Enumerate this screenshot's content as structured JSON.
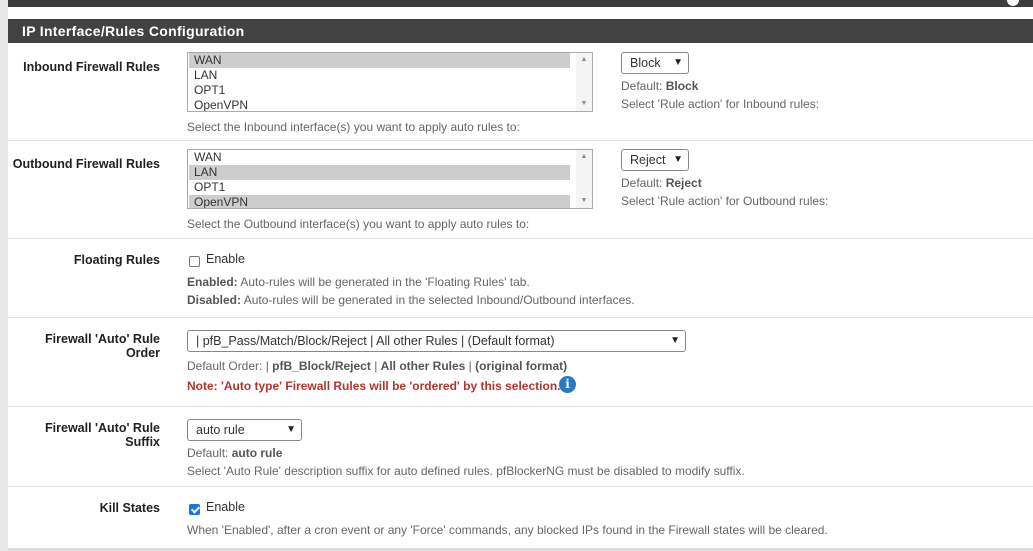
{
  "panel": {
    "title": "IP Interface/Rules Configuration"
  },
  "inbound": {
    "label": "Inbound Firewall Rules",
    "interfaces": [
      {
        "name": "WAN",
        "selected": true
      },
      {
        "name": "LAN",
        "selected": false
      },
      {
        "name": "OPT1",
        "selected": false
      },
      {
        "name": "OpenVPN",
        "selected": false
      }
    ],
    "help": "Select the Inbound interface(s) you want to apply auto rules to:",
    "action_value": "Block",
    "default_prefix": "Default: ",
    "default_value": "Block",
    "action_help": "Select 'Rule action' for Inbound rules:"
  },
  "outbound": {
    "label": "Outbound Firewall Rules",
    "interfaces": [
      {
        "name": "WAN",
        "selected": false
      },
      {
        "name": "LAN",
        "selected": true
      },
      {
        "name": "OPT1",
        "selected": false
      },
      {
        "name": "OpenVPN",
        "selected": true
      }
    ],
    "help": "Select the Outbound interface(s) you want to apply auto rules to:",
    "action_value": "Reject",
    "default_prefix": "Default: ",
    "default_value": "Reject",
    "action_help": "Select 'Rule action' for Outbound rules:"
  },
  "floating": {
    "label": "Floating Rules",
    "checkbox_label": "Enable",
    "checked": false,
    "enabled_prefix": "Enabled:",
    "enabled_text": " Auto-rules will be generated in the 'Floating Rules' tab.",
    "disabled_prefix": "Disabled:",
    "disabled_text": " Auto-rules will be generated in the selected Inbound/Outbound interfaces."
  },
  "order": {
    "label": "Firewall 'Auto' Rule Order",
    "value": "| pfB_Pass/Match/Block/Reject | All other Rules | (Default format)",
    "default_prefix": "Default Order: | ",
    "default_part1": "pfB_Block/Reject",
    "sep1": " | ",
    "default_part2": "All other Rules",
    "sep2": " | ",
    "default_part3": "(original format)",
    "note": "Note: 'Auto type' Firewall Rules will be 'ordered' by this selection.",
    "info_icon": "info-icon"
  },
  "suffix": {
    "label": "Firewall 'Auto' Rule Suffix",
    "value": "auto rule",
    "default_prefix": "Default: ",
    "default_value": "auto rule",
    "help": "Select 'Auto Rule' description suffix for auto defined rules. pfBlockerNG must be disabled to modify suffix."
  },
  "kill_states": {
    "label": "Kill States",
    "checkbox_label": "Enable",
    "checked": true,
    "help": "When 'Enabled', after a cron event or any 'Force' commands, any blocked IPs found in the Firewall states will be cleared."
  },
  "colors": {
    "heading_bg": "#424242",
    "note_red": "#b5342a",
    "info_blue": "#2a7ac0",
    "checkbox_blue": "#1a73e8"
  }
}
